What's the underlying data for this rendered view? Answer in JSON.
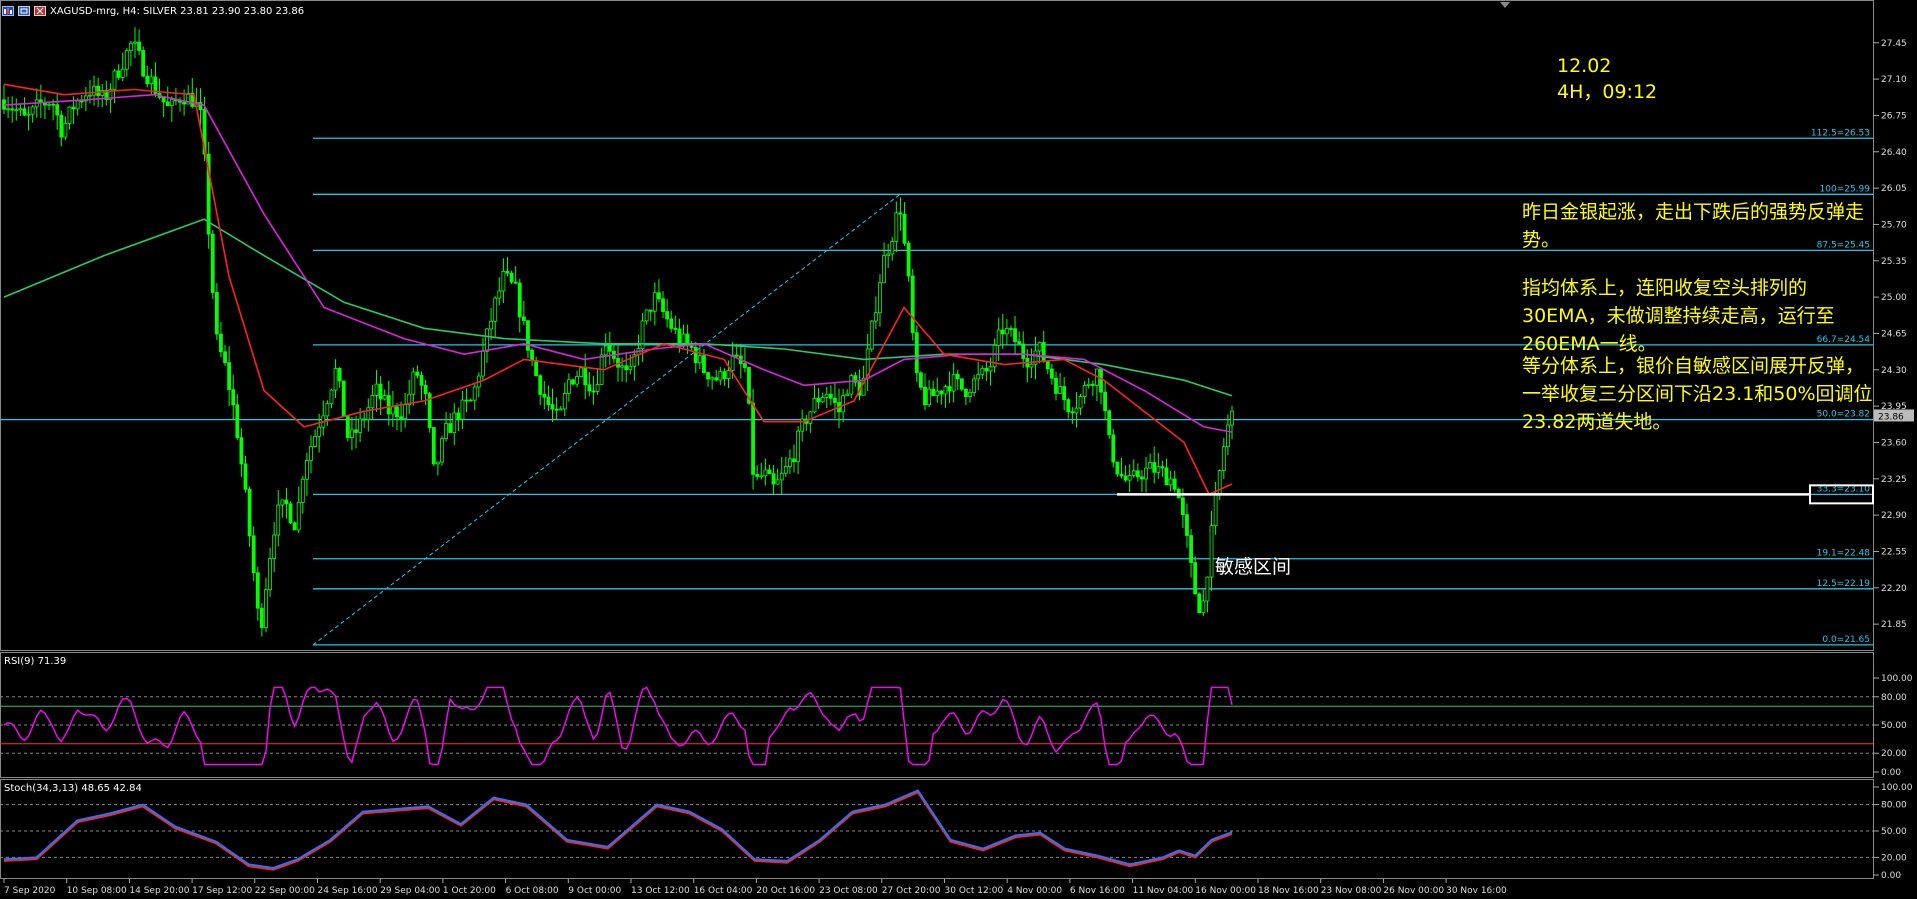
{
  "window": {
    "title": "XAGUSD-mrg, H4:  SILVER  23.81 23.90 23.80 23.86",
    "icons": [
      "chart-window-icon",
      "maximize-icon",
      "close-icon"
    ]
  },
  "colors": {
    "background": "#000000",
    "candle": "#00ff00",
    "fib_line": "#1ec8e6",
    "ema30": "#ff2020",
    "ema60": "#e020e0",
    "ema260": "#22cc66",
    "rsi_line": "#ff00ff",
    "stoch_main": "#2277ff",
    "stoch_signal": "#ff2222",
    "annotation": "#ffff00",
    "horizontal_marker": "#ffffff"
  },
  "annotation": {
    "date": "12.02",
    "timeframe": "4H，09:12",
    "paragraph1": "昨日金银起涨，走出下跌后的强势反弹走势。",
    "paragraph2": "指均体系上，连阳收复空头排列的30EMA，未做调整持续走高，运行至260EMA一线。",
    "paragraph3": "等分体系上，银价自敏感区间展开反弹，一举收复三分区间下沿23.1和50%回调位23.82两道失地。",
    "zone_label": "敏感区间"
  },
  "fib_levels": [
    {
      "label": "112.5=26.53",
      "price": 26.53
    },
    {
      "label": "100=25.99",
      "price": 25.99
    },
    {
      "label": "87.5=25.45",
      "price": 25.45
    },
    {
      "label": "66.7=24.54",
      "price": 24.54
    },
    {
      "label": "50.0=23.82",
      "price": 23.82
    },
    {
      "label": "33.3=23.10",
      "price": 23.1
    },
    {
      "label": "19.1=22.48",
      "price": 22.48
    },
    {
      "label": "12.5=22.19",
      "price": 22.19
    },
    {
      "label": "0.0=21.65",
      "price": 21.65
    }
  ],
  "price_axis": {
    "ticks": [
      "27.45",
      "27.10",
      "26.75",
      "26.40",
      "26.05",
      "25.70",
      "25.35",
      "25.00",
      "24.65",
      "24.30",
      "23.95",
      "23.60",
      "23.25",
      "22.90",
      "22.55",
      "22.20",
      "21.85"
    ],
    "current_price": "23.86",
    "range": [
      21.62,
      27.65
    ]
  },
  "rsi": {
    "label": "RSI(9) 71.39",
    "ticks": [
      "100.00",
      "80.00",
      "50.00",
      "20.00",
      "0.00"
    ],
    "levels": [
      70,
      30
    ]
  },
  "stoch": {
    "label": "Stoch(34,3,13) 48.65 42.84",
    "ticks": [
      "100.00",
      "80.00",
      "50.00",
      "20.00",
      "0.00"
    ]
  },
  "time_axis": {
    "labels": [
      "7 Sep 2020",
      "10 Sep 08:00",
      "14 Sep 20:00",
      "17 Sep 12:00",
      "22 Sep 00:00",
      "24 Sep 16:00",
      "29 Sep 04:00",
      "1 Oct 20:00",
      "6 Oct 08:00",
      "9 Oct 00:00",
      "13 Oct 12:00",
      "16 Oct 04:00",
      "20 Oct 16:00",
      "23 Oct 08:00",
      "27 Oct 20:00",
      "30 Oct 12:00",
      "4 Nov 00:00",
      "6 Nov 16:00",
      "11 Nov 04:00",
      "16 Nov 00:00",
      "18 Nov 16:00",
      "23 Nov 08:00",
      "26 Nov 00:00",
      "30 Nov 16:00"
    ]
  },
  "chart_data": {
    "type": "candlestick",
    "symbol": "XAGUSD-mrg",
    "timeframe": "H4",
    "close_path": [
      [
        0,
        26.9
      ],
      [
        12,
        26.8
      ],
      [
        22,
        26.7
      ],
      [
        35,
        26.85
      ],
      [
        48,
        26.9
      ],
      [
        58,
        26.6
      ],
      [
        70,
        26.85
      ],
      [
        85,
        27.0
      ],
      [
        100,
        26.9
      ],
      [
        115,
        27.2
      ],
      [
        128,
        27.45
      ],
      [
        140,
        27.2
      ],
      [
        152,
        27.0
      ],
      [
        165,
        26.8
      ],
      [
        178,
        26.95
      ],
      [
        190,
        26.9
      ],
      [
        198,
        26.7
      ],
      [
        205,
        25.6
      ],
      [
        212,
        24.6
      ],
      [
        222,
        24.3
      ],
      [
        232,
        23.8
      ],
      [
        240,
        23.2
      ],
      [
        248,
        22.5
      ],
      [
        256,
        21.75
      ],
      [
        264,
        22.4
      ],
      [
        272,
        22.9
      ],
      [
        282,
        23.0
      ],
      [
        292,
        22.8
      ],
      [
        300,
        23.4
      ],
      [
        312,
        23.7
      ],
      [
        322,
        24.0
      ],
      [
        332,
        24.3
      ],
      [
        345,
        23.6
      ],
      [
        358,
        23.8
      ],
      [
        372,
        24.1
      ],
      [
        385,
        23.9
      ],
      [
        400,
        23.9
      ],
      [
        412,
        24.3
      ],
      [
        422,
        24.0
      ],
      [
        430,
        23.3
      ],
      [
        442,
        23.7
      ],
      [
        455,
        23.9
      ],
      [
        468,
        24.0
      ],
      [
        480,
        24.5
      ],
      [
        490,
        24.9
      ],
      [
        500,
        25.2
      ],
      [
        512,
        25.05
      ],
      [
        520,
        24.7
      ],
      [
        530,
        24.3
      ],
      [
        542,
        24.0
      ],
      [
        555,
        23.8
      ],
      [
        565,
        24.2
      ],
      [
        578,
        24.3
      ],
      [
        590,
        24.1
      ],
      [
        602,
        24.6
      ],
      [
        612,
        24.4
      ],
      [
        625,
        24.2
      ],
      [
        638,
        24.7
      ],
      [
        650,
        25.0
      ],
      [
        662,
        24.8
      ],
      [
        675,
        24.6
      ],
      [
        688,
        24.5
      ],
      [
        700,
        24.3
      ],
      [
        715,
        24.2
      ],
      [
        728,
        24.4
      ],
      [
        742,
        24.3
      ],
      [
        750,
        23.2
      ],
      [
        760,
        23.3
      ],
      [
        770,
        23.15
      ],
      [
        780,
        23.3
      ],
      [
        790,
        23.5
      ],
      [
        800,
        23.8
      ],
      [
        812,
        24.0
      ],
      [
        822,
        24.1
      ],
      [
        835,
        23.9
      ],
      [
        845,
        24.2
      ],
      [
        858,
        24.1
      ],
      [
        868,
        24.7
      ],
      [
        878,
        25.3
      ],
      [
        888,
        25.6
      ],
      [
        896,
        25.9
      ],
      [
        905,
        25.1
      ],
      [
        912,
        24.2
      ],
      [
        922,
        24.0
      ],
      [
        935,
        24.1
      ],
      [
        948,
        24.2
      ],
      [
        960,
        24.1
      ],
      [
        972,
        24.2
      ],
      [
        985,
        24.3
      ],
      [
        998,
        24.7
      ],
      [
        1010,
        24.6
      ],
      [
        1022,
        24.4
      ],
      [
        1035,
        24.5
      ],
      [
        1045,
        24.3
      ],
      [
        1055,
        24.1
      ],
      [
        1065,
        23.95
      ],
      [
        1075,
        24.0
      ],
      [
        1085,
        24.2
      ],
      [
        1095,
        24.3
      ],
      [
        1105,
        23.6
      ],
      [
        1115,
        23.3
      ],
      [
        1125,
        23.2
      ],
      [
        1135,
        23.3
      ],
      [
        1148,
        23.35
      ],
      [
        1160,
        23.3
      ],
      [
        1172,
        23.2
      ],
      [
        1182,
        22.7
      ],
      [
        1190,
        22.2
      ],
      [
        1198,
        21.95
      ],
      [
        1206,
        22.6
      ],
      [
        1214,
        23.2
      ],
      [
        1222,
        23.7
      ],
      [
        1228,
        23.86
      ]
    ],
    "ema30_path": [
      [
        0,
        27.05
      ],
      [
        60,
        26.95
      ],
      [
        130,
        27.0
      ],
      [
        190,
        26.95
      ],
      [
        225,
        25.2
      ],
      [
        260,
        24.1
      ],
      [
        300,
        23.75
      ],
      [
        360,
        23.9
      ],
      [
        420,
        24.0
      ],
      [
        480,
        24.2
      ],
      [
        520,
        24.4
      ],
      [
        600,
        24.3
      ],
      [
        660,
        24.55
      ],
      [
        720,
        24.4
      ],
      [
        760,
        23.8
      ],
      [
        800,
        23.8
      ],
      [
        850,
        24.0
      ],
      [
        900,
        24.9
      ],
      [
        940,
        24.45
      ],
      [
        1000,
        24.35
      ],
      [
        1060,
        24.4
      ],
      [
        1100,
        24.2
      ],
      [
        1140,
        23.9
      ],
      [
        1180,
        23.6
      ],
      [
        1205,
        23.1
      ],
      [
        1228,
        23.2
      ]
    ],
    "ema60_path": [
      [
        0,
        26.85
      ],
      [
        80,
        26.9
      ],
      [
        150,
        26.95
      ],
      [
        200,
        26.85
      ],
      [
        260,
        25.8
      ],
      [
        320,
        24.9
      ],
      [
        400,
        24.6
      ],
      [
        460,
        24.45
      ],
      [
        520,
        24.55
      ],
      [
        580,
        24.4
      ],
      [
        650,
        24.5
      ],
      [
        700,
        24.55
      ],
      [
        760,
        24.3
      ],
      [
        800,
        24.15
      ],
      [
        860,
        24.2
      ],
      [
        900,
        24.4
      ],
      [
        960,
        24.45
      ],
      [
        1020,
        24.45
      ],
      [
        1080,
        24.4
      ],
      [
        1140,
        24.1
      ],
      [
        1200,
        23.75
      ],
      [
        1228,
        23.7
      ]
    ],
    "ema260_path": [
      [
        0,
        25.0
      ],
      [
        100,
        25.4
      ],
      [
        200,
        25.75
      ],
      [
        260,
        25.4
      ],
      [
        340,
        24.95
      ],
      [
        420,
        24.7
      ],
      [
        500,
        24.6
      ],
      [
        600,
        24.55
      ],
      [
        700,
        24.55
      ],
      [
        780,
        24.5
      ],
      [
        860,
        24.4
      ],
      [
        940,
        24.45
      ],
      [
        1020,
        24.45
      ],
      [
        1100,
        24.35
      ],
      [
        1180,
        24.2
      ],
      [
        1228,
        24.05
      ]
    ],
    "fib_anchor": {
      "low": 21.65,
      "high": 25.99
    },
    "sensitive_zone": [
      22.19,
      22.48
    ],
    "rsi_last": 71.39,
    "stoch_main_last": 48.65,
    "stoch_signal_last": 42.84
  }
}
